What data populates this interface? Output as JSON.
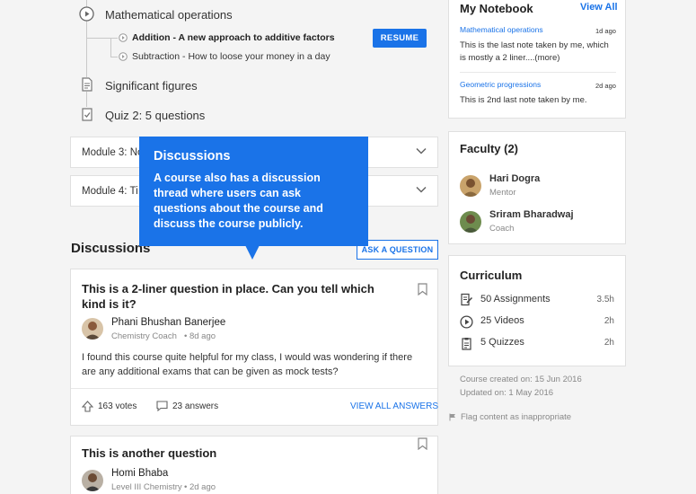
{
  "timeline": {
    "top_item": "Mathematical operations",
    "sub_items": [
      {
        "label": "Addition - A new approach to additive factors",
        "bold": true
      },
      {
        "label": "Subtraction - How to loose your money in a day",
        "bold": false
      }
    ],
    "resume_label": "RESUME",
    "items": [
      {
        "label": "Significant figures"
      },
      {
        "label": "Quiz 2: 5 questions"
      }
    ]
  },
  "modules": [
    {
      "label": "Module 3: No"
    },
    {
      "label": "Module 4: Ti"
    }
  ],
  "tooltip": {
    "title": "Discussions",
    "body": "A course also has a discussion thread where users can ask questions about the course and discuss the course publicly."
  },
  "discussions": {
    "heading": "Discussions",
    "ask_label": "ASK A QUESTION",
    "questions": [
      {
        "title": "This is a 2-liner question in place. Can you tell which kind is it?",
        "author": "Phani Bhushan Banerjee",
        "role": "Chemistry Coach",
        "time": "8d ago",
        "body": "I found this course quite helpful for my class, I would was wondering if there are any additional exams that can be given as mock tests?",
        "votes": "163 votes",
        "answers": "23 answers",
        "view_all": "VIEW ALL ANSWERS"
      },
      {
        "title": "This is another question",
        "author": "Homi Bhaba",
        "role": "Level III Chemistry",
        "time": "2d ago"
      }
    ]
  },
  "notebook": {
    "title": "My Notebook",
    "view_all": "View All",
    "notes": [
      {
        "link": "Mathematical operations",
        "date": "1d ago",
        "text": "This is the last note taken by me, which is mostly a 2 liner....(more)"
      },
      {
        "link": "Geometric progressions",
        "date": "2d ago",
        "text": "This is 2nd last note taken by me."
      }
    ]
  },
  "faculty": {
    "title": "Faculty (2)",
    "members": [
      {
        "name": "Hari Dogra",
        "role": "Mentor"
      },
      {
        "name": "Sriram Bharadwaj",
        "role": "Coach"
      }
    ]
  },
  "curriculum": {
    "title": "Curriculum",
    "items": [
      {
        "label": "50 Assignments",
        "value": "3.5h",
        "icon": "assignment-icon"
      },
      {
        "label": "25 Videos",
        "value": "2h",
        "icon": "video-icon"
      },
      {
        "label": "5 Quizzes",
        "value": "2h",
        "icon": "quiz-icon"
      }
    ],
    "created": "Course created on: 15 Jun 2016",
    "updated": "Updated on: 1 May 2016",
    "flag": "Flag content as inappropriate"
  },
  "colors": {
    "accent": "#1a73e8",
    "background": "#f4f4f4"
  }
}
